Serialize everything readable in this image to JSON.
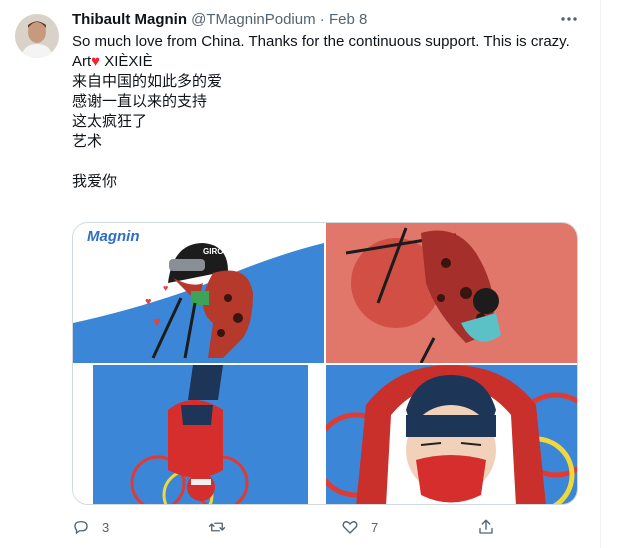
{
  "tweet": {
    "author_name": "Thibault Magnin",
    "handle": "@TMagninPodium",
    "separator": "·",
    "date": "Feb 8",
    "text_line1": "So much love from China. Thanks for the continuous support. This is crazy.",
    "text_art": "Art",
    "text_xiexie": " XIÈXIÈ",
    "text_cn": "\n来自中国的如此多的爱\n感谢一直以来的支持\n这太疯狂了\n艺术\n\n我爱你"
  },
  "media": {
    "image1_caption": "Magnin",
    "image1_helmet_text": "GIRO"
  },
  "actions": {
    "reply_count": "3",
    "retweet_count": "",
    "like_count": "7"
  },
  "icons": [
    "more-icon",
    "reply-icon",
    "retweet-icon",
    "like-icon",
    "share-icon",
    "heart-emoji-icon"
  ],
  "colors": {
    "heart": "#f4212e",
    "secondary_text": "#536471",
    "primary_text": "#0f1419"
  }
}
